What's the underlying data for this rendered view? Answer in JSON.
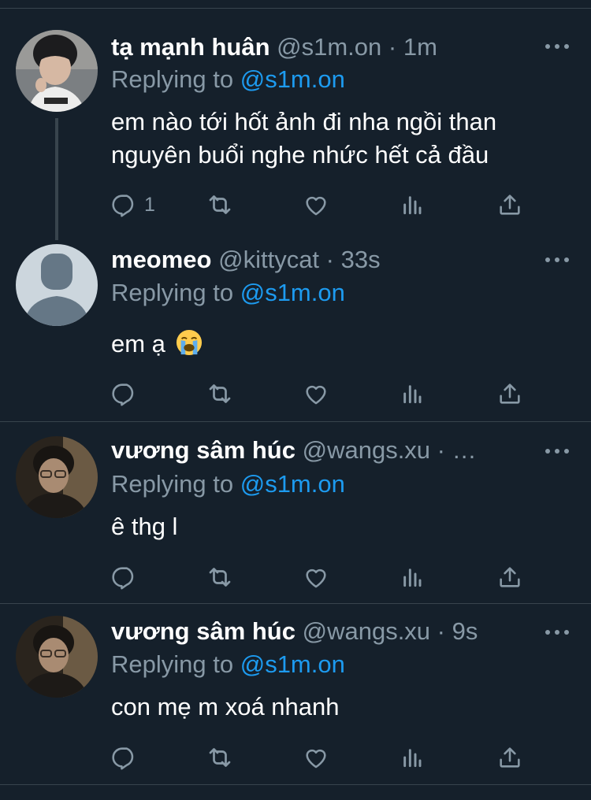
{
  "colors": {
    "background": "#15202b",
    "divider": "#38444d",
    "muted": "#8899a6",
    "link": "#1d9bf0",
    "text": "#ffffff"
  },
  "tweets": [
    {
      "name": "tạ mạnh huân",
      "handle": "@s1m.on",
      "dot": "·",
      "time": "1m",
      "reply_prefix": "Replying to",
      "reply_handle": "@s1m.on",
      "text_lines": [
        "em nào tới hốt ảnh đi nha ngồi than",
        "nguyên buổi nghe nhức hết cả đầu"
      ],
      "reply_count": "1",
      "icons": [
        "reply-icon",
        "retweet-icon",
        "like-icon",
        "analytics-icon",
        "share-icon"
      ]
    },
    {
      "name": "meomeo",
      "handle": "@kittycat",
      "dot": "·",
      "time": "33s",
      "reply_prefix": "Replying to",
      "reply_handle": "@s1m.on",
      "text": "em ạ",
      "emoji": "loudly-crying-face-emoji",
      "reply_count": ""
    },
    {
      "name": "vương sâm húc",
      "handle": "@wangs.xu",
      "dot": "· …",
      "time": "",
      "reply_prefix": "Replying to",
      "reply_handle": "@s1m.on",
      "text": "ê thg l",
      "reply_count": ""
    },
    {
      "name": "vương sâm húc",
      "handle": "@wangs.xu",
      "dot": "·",
      "time": "9s",
      "reply_prefix": "Replying to",
      "reply_handle": "@s1m.on",
      "text": "con mẹ m xoá nhanh",
      "reply_count": ""
    }
  ]
}
